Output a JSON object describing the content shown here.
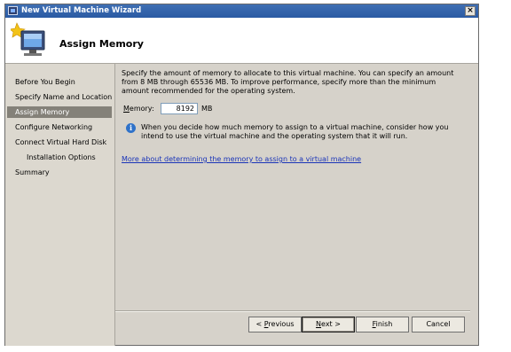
{
  "window": {
    "title": "New Virtual Machine Wizard",
    "close_glyph": "×"
  },
  "header": {
    "title": "Assign Memory",
    "icon": "monitor-with-star-icon"
  },
  "sidebar": {
    "items": [
      {
        "label": "Before You Begin",
        "active": false
      },
      {
        "label": "Specify Name and Location",
        "active": false
      },
      {
        "label": "Assign Memory",
        "active": true
      },
      {
        "label": "Configure Networking",
        "active": false
      },
      {
        "label": "Connect Virtual Hard Disk",
        "active": false
      },
      {
        "label": "Installation Options",
        "active": false,
        "sub": true
      },
      {
        "label": "Summary",
        "active": false
      }
    ]
  },
  "main": {
    "description": "Specify the amount of memory to allocate to this virtual machine. You can specify an amount from 8 MB through 65536 MB. To improve performance, specify more than the minimum amount recommended for the operating system.",
    "memory": {
      "label": "Memory:",
      "value": "8192",
      "unit": "MB"
    },
    "info_text": "When you decide how much memory to assign to a virtual machine, consider how you intend to use the virtual machine and the operating system that it will run.",
    "link": "More about determining the memory to assign to a virtual machine"
  },
  "buttons": {
    "previous": "< Previous",
    "next": "Next >",
    "finish": "Finish",
    "cancel": "Cancel"
  },
  "colors": {
    "titlebar": "#2a5aa3",
    "active_nav": "#848179",
    "link": "#1a34b8",
    "dialog_bg": "#d6d2ca"
  }
}
